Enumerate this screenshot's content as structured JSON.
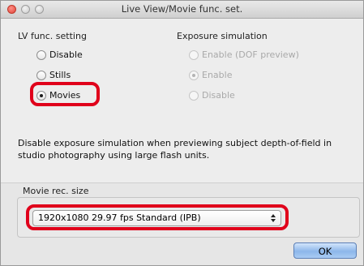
{
  "window": {
    "title": "Live View/Movie func. set."
  },
  "lv_func": {
    "heading": "LV func. setting",
    "options": [
      {
        "label": "Disable",
        "checked": false
      },
      {
        "label": "Stills",
        "checked": false
      },
      {
        "label": "Movies",
        "checked": true
      }
    ]
  },
  "exposure_sim": {
    "heading": "Exposure simulation",
    "enabled": false,
    "options": [
      {
        "label": "Enable (DOF preview)",
        "checked": false
      },
      {
        "label": "Enable",
        "checked": true
      },
      {
        "label": "Disable",
        "checked": false
      }
    ]
  },
  "description": "Disable exposure simulation when previewing subject depth-of-field in studio photography using large flash units.",
  "movie_rec_size": {
    "label": "Movie rec. size",
    "selected": "1920x1080 29.97 fps  Standard (IPB)"
  },
  "buttons": {
    "ok": "OK"
  },
  "colors": {
    "highlight": "#e0001b",
    "ok_button": "#8db7ea"
  }
}
